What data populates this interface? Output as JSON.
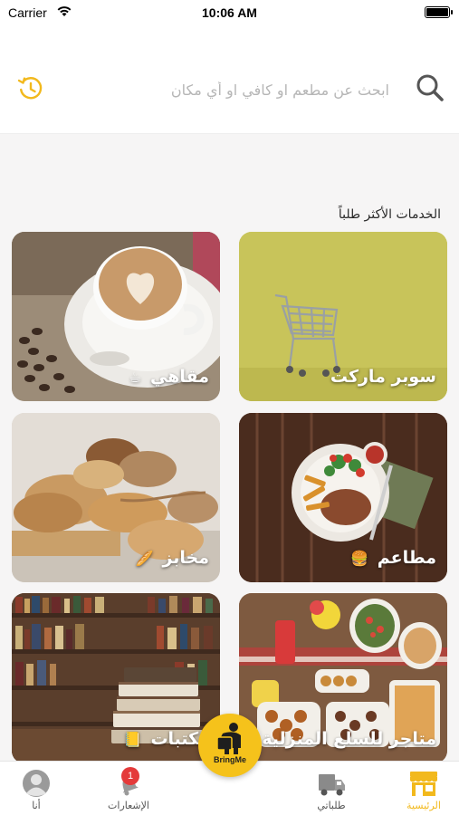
{
  "status_bar": {
    "carrier": "Carrier",
    "time": "10:06 AM"
  },
  "search": {
    "placeholder": "ابحث عن مطعم او كافي او أي مكان",
    "value": ""
  },
  "section_title": "الخدمات الأكثر طلباً",
  "tiles": [
    {
      "label": "سوبر ماركت",
      "emoji": ""
    },
    {
      "label": "مقاهي",
      "emoji": "☕"
    },
    {
      "label": "مطاعم",
      "emoji": "🍔"
    },
    {
      "label": "مخابز",
      "emoji": "🥖"
    },
    {
      "label": "متاجر للسلع المنزلية",
      "emoji": "🏪"
    },
    {
      "label": "مكتبات",
      "emoji": "📒"
    }
  ],
  "tabbar": {
    "home": "الرئيسية",
    "orders": "طلباتي",
    "center": "BringMe",
    "notifications": "الإشعارات",
    "notifications_badge": "1",
    "me": "أنا"
  },
  "colors": {
    "accent": "#f5c21b",
    "badge": "#e43a3a"
  }
}
